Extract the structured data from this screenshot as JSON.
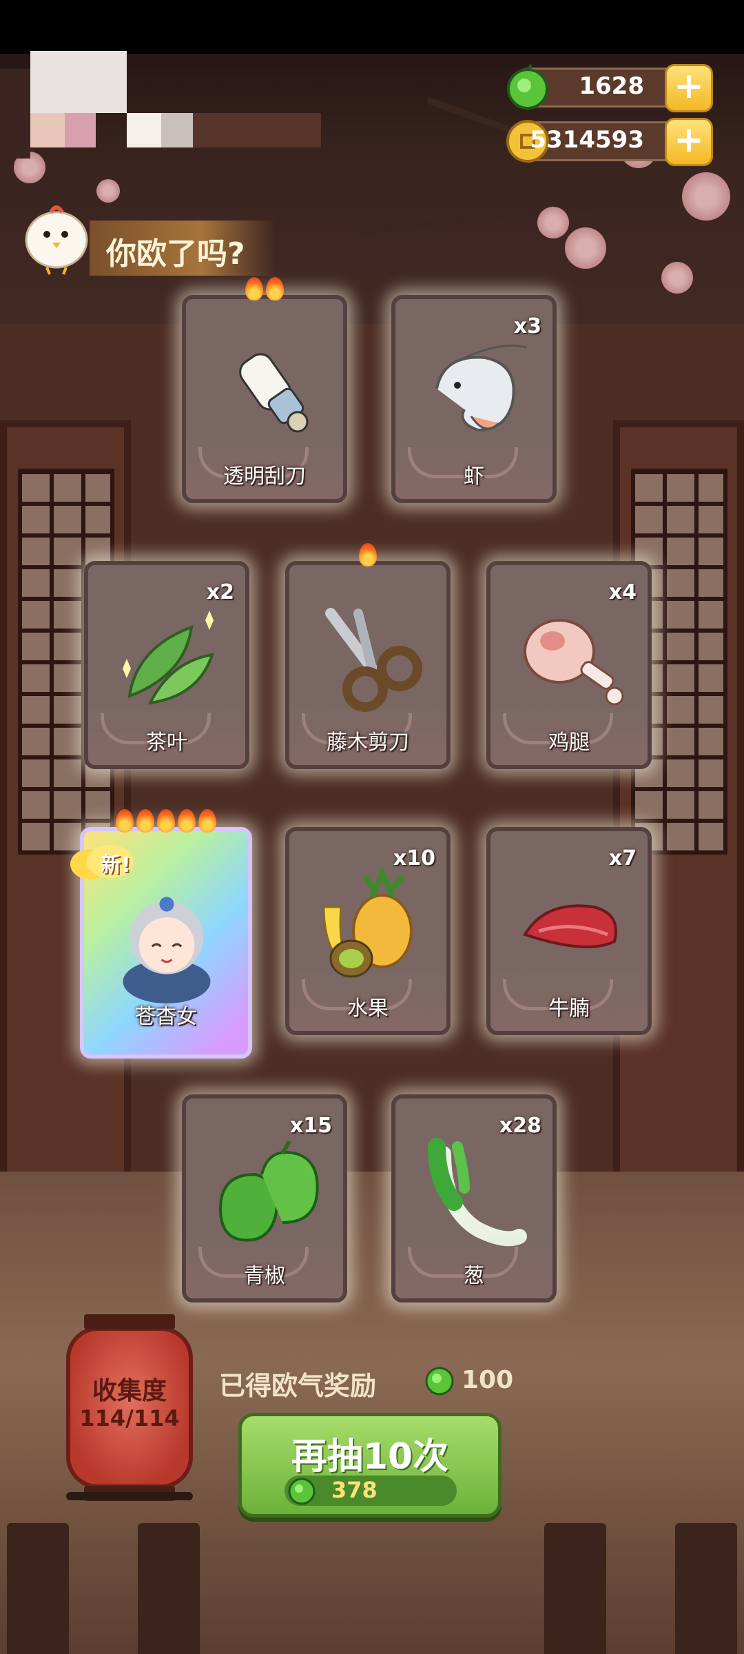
{
  "currency": {
    "green_value": "1628",
    "gold_value": "5314593",
    "plus_symbol": "+"
  },
  "banner": {
    "text": "你欧了吗?"
  },
  "cards": [
    {
      "name": "透明刮刀",
      "qty": "",
      "flames": 2,
      "art": "scraper-icon"
    },
    {
      "name": "虾",
      "qty": "x3",
      "flames": 0,
      "art": "shrimp-icon"
    },
    {
      "name": "茶叶",
      "qty": "x2",
      "flames": 0,
      "art": "tea-leaf-icon"
    },
    {
      "name": "藤木剪刀",
      "qty": "",
      "flames": 1,
      "art": "scissors-icon"
    },
    {
      "name": "鸡腿",
      "qty": "x4",
      "flames": 0,
      "art": "chicken-leg-icon"
    },
    {
      "name": "苍杳女",
      "qty": "",
      "flames": 5,
      "art": "character-portrait",
      "new_label": "新!"
    },
    {
      "name": "水果",
      "qty": "x10",
      "flames": 0,
      "art": "fruit-icon"
    },
    {
      "name": "牛腩",
      "qty": "x7",
      "flames": 0,
      "art": "beef-icon"
    },
    {
      "name": "青椒",
      "qty": "x15",
      "flames": 0,
      "art": "green-pepper-icon"
    },
    {
      "name": "葱",
      "qty": "x28",
      "flames": 0,
      "art": "scallion-icon"
    }
  ],
  "collection": {
    "label": "收集度",
    "value": "114/114"
  },
  "reward": {
    "label": "已得欧气奖励",
    "value": "100"
  },
  "draw_button": {
    "label": "再抽10次",
    "cost": "378"
  },
  "colors": {
    "accent_green": "#6cb23a",
    "gold": "#f3b825",
    "lantern_red": "#b8392c"
  }
}
